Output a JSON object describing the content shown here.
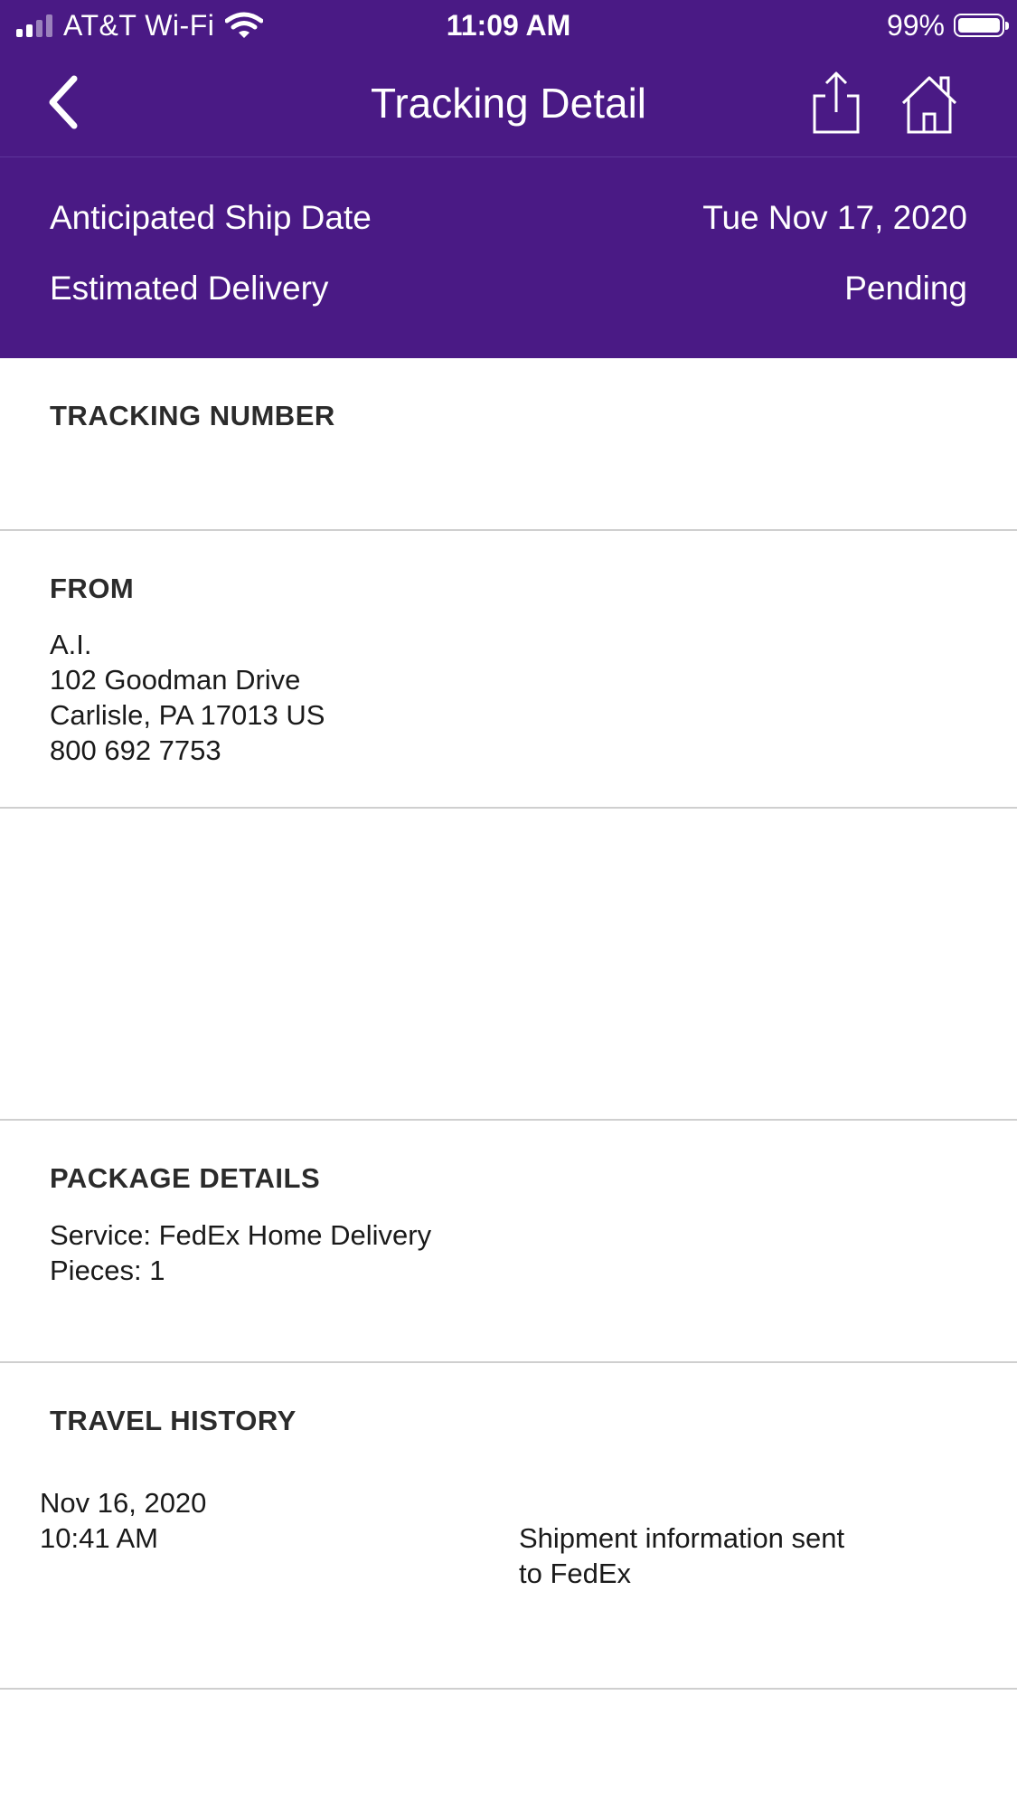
{
  "status_bar": {
    "carrier": "AT&T Wi-Fi",
    "time": "11:09 AM",
    "battery_percent": "99%",
    "battery_level": 0.99,
    "signal_bars": 2
  },
  "nav": {
    "title": "Tracking Detail",
    "icons": {
      "back": "chevron-left-icon",
      "share": "share-icon",
      "home": "home-icon"
    }
  },
  "summary": {
    "ship_date_label": "Anticipated Ship Date",
    "ship_date_value": "Tue Nov 17, 2020",
    "delivery_label": "Estimated Delivery",
    "delivery_value": "Pending"
  },
  "tracking_number": {
    "heading": "TRACKING NUMBER"
  },
  "from": {
    "heading": "FROM",
    "lines": [
      "A.I.",
      "102 Goodman Drive",
      "Carlisle, PA 17013 US",
      "800 692 7753"
    ]
  },
  "package_details": {
    "heading": "PACKAGE DETAILS",
    "service": "Service: FedEx Home Delivery",
    "pieces": "Pieces: 1"
  },
  "travel_history": {
    "heading": "TRAVEL HISTORY",
    "events": [
      {
        "date": "Nov 16, 2020",
        "time": "10:41 AM",
        "description_line1": "Shipment information sent",
        "description_line2": "to FedEx"
      }
    ]
  },
  "colors": {
    "header_background": "#4a1a85",
    "header_text": "#ffffff",
    "divider": "#cfcfcf"
  }
}
